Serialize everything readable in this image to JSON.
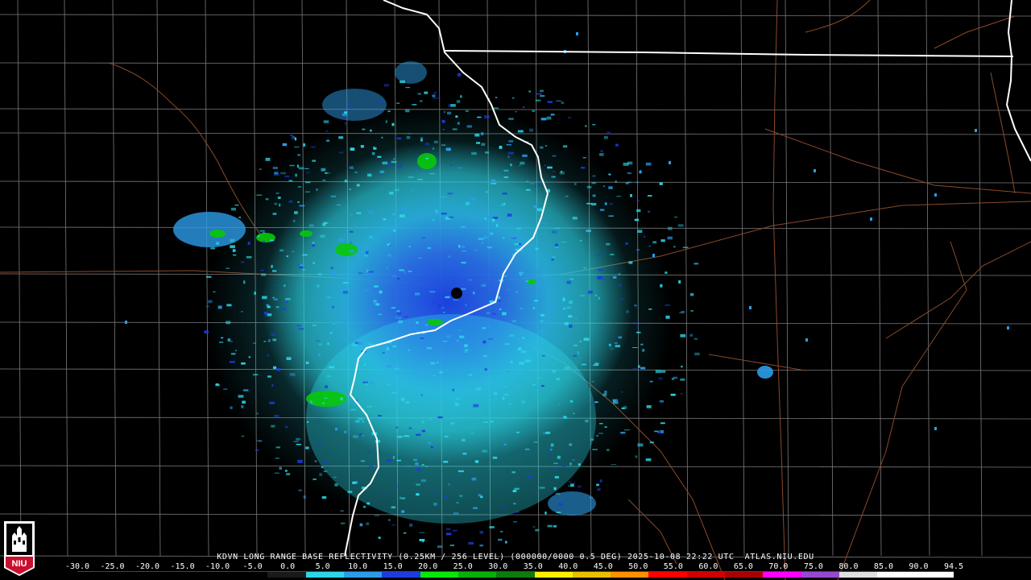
{
  "product_title": "KDVN LONG RANGE BASE REFLECTIVITY (0.25KM / 256 LEVEL) (000000/0000 0.5 DEG) 2025-10-08 22:22 UTC  ATLAS.NIU.EDU",
  "radar_site": "KDVN",
  "logo": {
    "text": "NIU",
    "icon": "niu-huskie-tower-logo",
    "color": "#c8102e"
  },
  "colors": {
    "background": "#000000",
    "state_border": "#ffffff",
    "county_lines": "#7a7a7a",
    "highways": "#8b4a2a",
    "radar_site_marker": "#000000"
  },
  "legend": {
    "ticks": [
      "-30.0",
      "-25.0",
      "-20.0",
      "-15.0",
      "-10.0",
      "-5.0",
      "0.0",
      "5.0",
      "10.0",
      "15.0",
      "20.0",
      "25.0",
      "30.0",
      "35.0",
      "40.0",
      "45.0",
      "50.0",
      "55.0",
      "60.0",
      "65.0",
      "70.0",
      "75.0",
      "80.0",
      "85.0",
      "90.0",
      "94.5"
    ],
    "colors": [
      "#000000",
      "#000000",
      "#000000",
      "#000000",
      "#000000",
      "#1a1a1a",
      "#2cd6e8",
      "#2c9ce8",
      "#1c3ce0",
      "#08e808",
      "#08b008",
      "#0c7c0c",
      "#fff000",
      "#e8c000",
      "#ff9000",
      "#ff0000",
      "#d00000",
      "#a80000",
      "#ff00ff",
      "#9848d0",
      "#e0e0e0",
      "#ffffff",
      "#ffffff"
    ]
  }
}
